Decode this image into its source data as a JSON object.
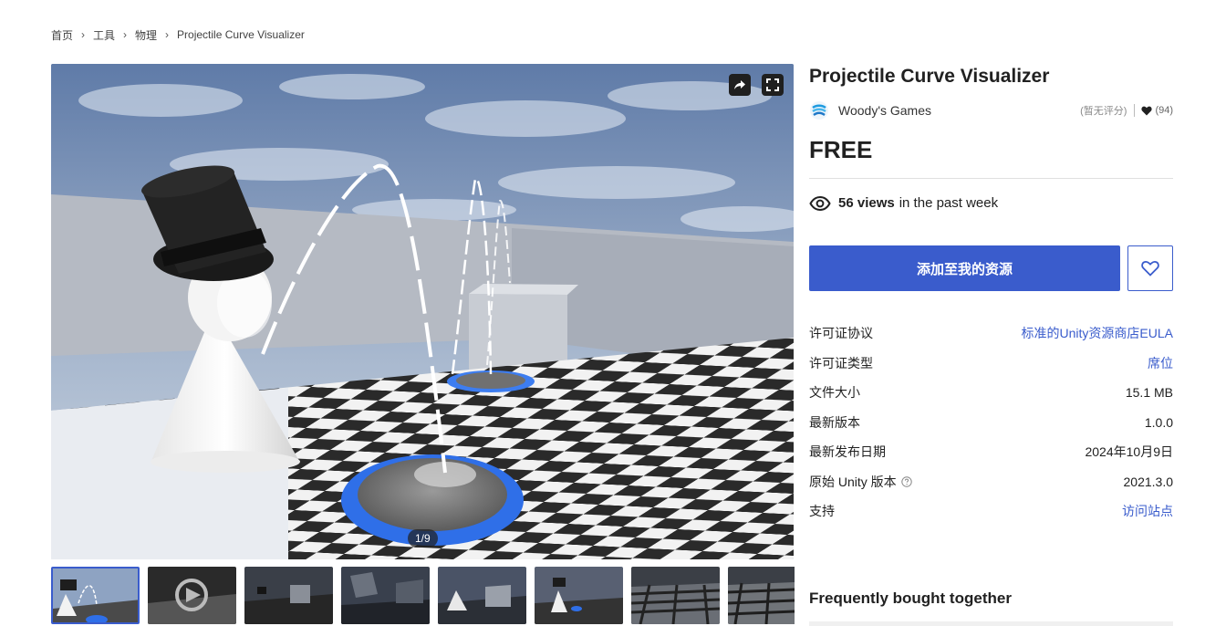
{
  "breadcrumb": [
    {
      "label": "首页"
    },
    {
      "label": "工具"
    },
    {
      "label": "物理"
    },
    {
      "label": "Projectile Curve Visualizer"
    }
  ],
  "viewer": {
    "counter": "1/9",
    "current_index": 1,
    "total": 9,
    "share_icon": "share-arrow-icon",
    "fullscreen_icon": "fullscreen-icon"
  },
  "thumbnails": [
    {
      "id": 1,
      "active": true
    },
    {
      "id": 2,
      "active": false
    },
    {
      "id": 3,
      "active": false
    },
    {
      "id": 4,
      "active": false
    },
    {
      "id": 5,
      "active": false
    },
    {
      "id": 6,
      "active": false
    },
    {
      "id": 7,
      "active": false
    },
    {
      "id": 8,
      "active": false
    }
  ],
  "product": {
    "title": "Projectile Curve Visualizer",
    "publisher": "Woody's Games",
    "rating_text": "(暂无评分)",
    "favorites": "(94)",
    "price": "FREE",
    "views_count": "56 views",
    "views_text": "in the past week",
    "add_button": "添加至我的资源",
    "wishlist_icon": "heart-outline-icon"
  },
  "details": [
    {
      "label": "许可证协议",
      "value": "标准的Unity资源商店EULA",
      "link": true
    },
    {
      "label": "许可证类型",
      "value": "席位",
      "link": true
    },
    {
      "label": "文件大小",
      "value": "15.1 MB",
      "link": false
    },
    {
      "label": "最新版本",
      "value": "1.0.0",
      "link": false
    },
    {
      "label": "最新发布日期",
      "value": "2024年10月9日",
      "link": false
    },
    {
      "label": "原始 Unity 版本",
      "value": "2021.3.0",
      "link": false,
      "help": true
    },
    {
      "label": "支持",
      "value": "访问站点",
      "link": true
    }
  ],
  "frequently_bought": "Frequently bought together",
  "colors": {
    "accent": "#3a5ccc",
    "text": "#212121",
    "muted": "#888888"
  }
}
